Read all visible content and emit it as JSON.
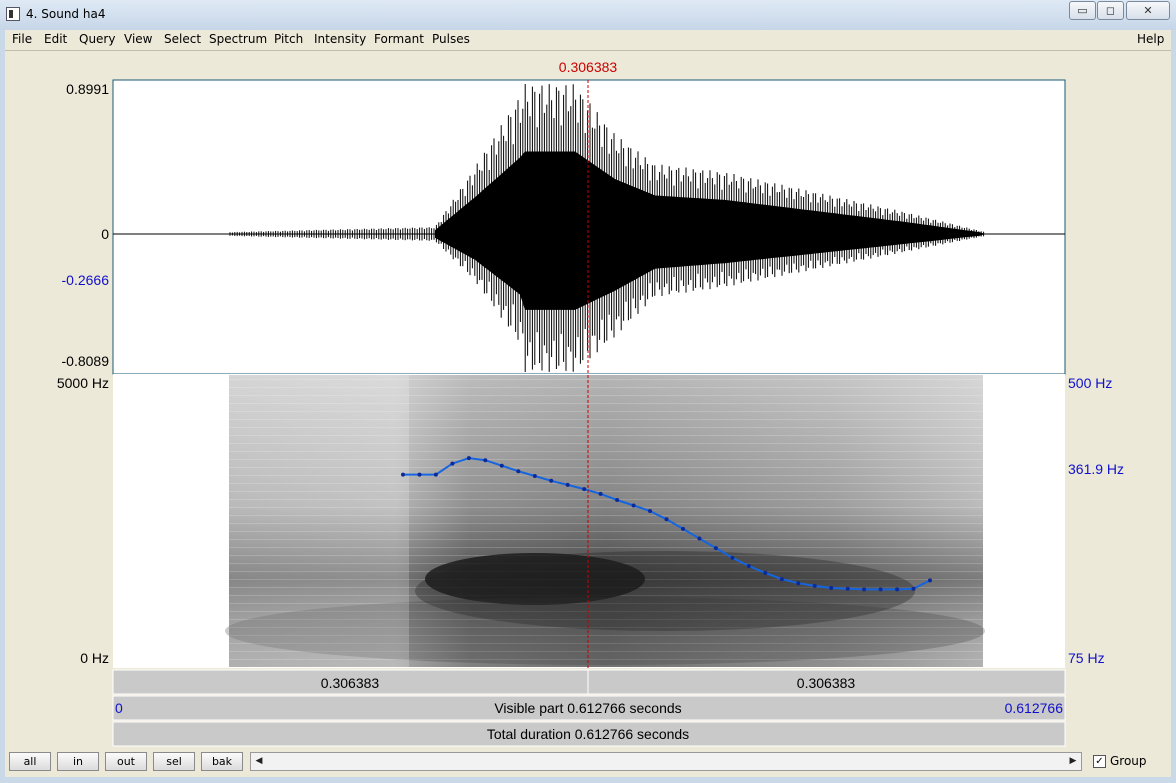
{
  "window": {
    "title": "4. Sound ha4",
    "minimize_glyph": "▭",
    "maximize_glyph": "◻",
    "close_glyph": "✕"
  },
  "menu": {
    "items": [
      "File",
      "Edit",
      "Query",
      "View",
      "Select",
      "Spectrum",
      "Pitch",
      "Intensity",
      "Formant",
      "Pulses"
    ],
    "help": "Help"
  },
  "editor": {
    "cursor_label": "0.306383",
    "waveform": {
      "max_label": "0.8991",
      "zero_label": "0",
      "cursor_value_label": "-0.2666",
      "min_label": "-0.8089"
    },
    "spectrogram": {
      "freq_max_label": "5000 Hz",
      "freq_min_label": "0 Hz"
    },
    "pitch": {
      "max_label": "500 Hz",
      "cursor_label": "361.9 Hz",
      "min_label": "75 Hz",
      "line_color": "#1565e0",
      "track_hz": [
        355,
        355,
        355,
        371,
        379,
        376,
        368,
        360,
        353,
        346,
        340,
        334,
        327,
        318,
        310,
        302,
        290,
        276,
        262,
        248,
        234,
        222,
        212,
        203,
        197,
        193,
        190,
        189,
        188,
        188,
        188,
        189,
        201
      ]
    },
    "selection_bar": {
      "left_duration": "0.306383",
      "right_duration": "0.306383"
    },
    "visible_bar": {
      "start": "0",
      "label": "Visible part 0.612766 seconds",
      "end": "0.612766"
    },
    "total_bar": {
      "label": "Total duration 0.612766 seconds"
    }
  },
  "bottom": {
    "buttons": [
      "all",
      "in",
      "out",
      "sel",
      "bak"
    ],
    "group_label": "Group",
    "group_checked": "✓",
    "scroll_left": "◀",
    "scroll_right": "▶"
  },
  "colors": {
    "cursor": "#cc0000",
    "axis_blue": "#1010cc",
    "pitch_line": "#1565e0",
    "panel_bg": "#ece9d8"
  }
}
